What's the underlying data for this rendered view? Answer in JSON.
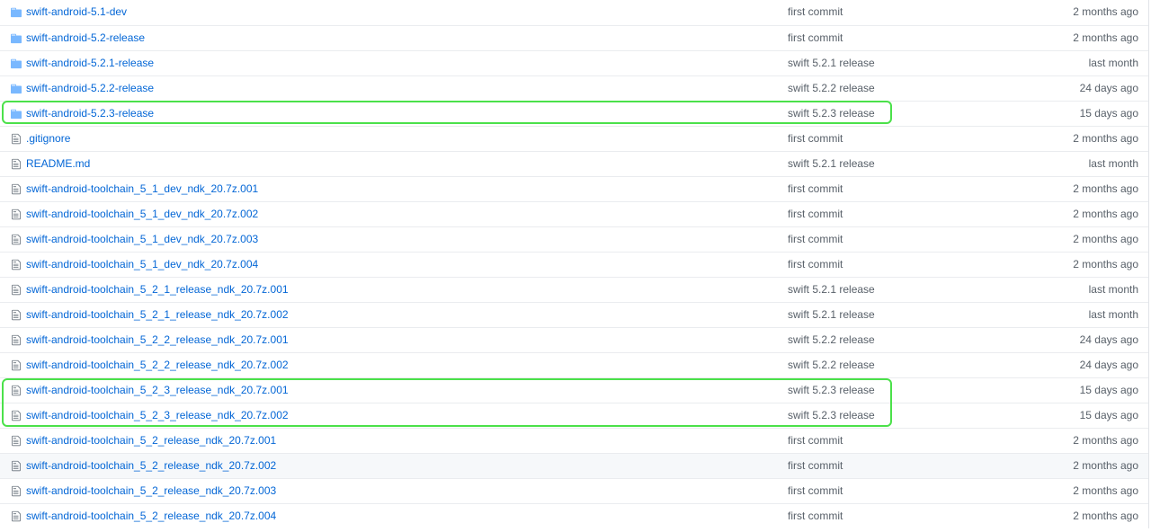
{
  "files": [
    {
      "type": "dir",
      "name": "swift-android-5.1-dev",
      "message": "first commit",
      "age": "2 months ago"
    },
    {
      "type": "dir",
      "name": "swift-android-5.2-release",
      "message": "first commit",
      "age": "2 months ago"
    },
    {
      "type": "dir",
      "name": "swift-android-5.2.1-release",
      "message": "swift 5.2.1 release",
      "age": "last month"
    },
    {
      "type": "dir",
      "name": "swift-android-5.2.2-release",
      "message": "swift 5.2.2 release",
      "age": "24 days ago"
    },
    {
      "type": "dir",
      "name": "swift-android-5.2.3-release",
      "message": "swift 5.2.3 release",
      "age": "15 days ago"
    },
    {
      "type": "file",
      "name": ".gitignore",
      "message": "first commit",
      "age": "2 months ago"
    },
    {
      "type": "file",
      "name": "README.md",
      "message": "swift 5.2.1 release",
      "age": "last month"
    },
    {
      "type": "file",
      "name": "swift-android-toolchain_5_1_dev_ndk_20.7z.001",
      "message": "first commit",
      "age": "2 months ago"
    },
    {
      "type": "file",
      "name": "swift-android-toolchain_5_1_dev_ndk_20.7z.002",
      "message": "first commit",
      "age": "2 months ago"
    },
    {
      "type": "file",
      "name": "swift-android-toolchain_5_1_dev_ndk_20.7z.003",
      "message": "first commit",
      "age": "2 months ago"
    },
    {
      "type": "file",
      "name": "swift-android-toolchain_5_1_dev_ndk_20.7z.004",
      "message": "first commit",
      "age": "2 months ago"
    },
    {
      "type": "file",
      "name": "swift-android-toolchain_5_2_1_release_ndk_20.7z.001",
      "message": "swift 5.2.1 release",
      "age": "last month"
    },
    {
      "type": "file",
      "name": "swift-android-toolchain_5_2_1_release_ndk_20.7z.002",
      "message": "swift 5.2.1 release",
      "age": "last month"
    },
    {
      "type": "file",
      "name": "swift-android-toolchain_5_2_2_release_ndk_20.7z.001",
      "message": "swift 5.2.2 release",
      "age": "24 days ago"
    },
    {
      "type": "file",
      "name": "swift-android-toolchain_5_2_2_release_ndk_20.7z.002",
      "message": "swift 5.2.2 release",
      "age": "24 days ago"
    },
    {
      "type": "file",
      "name": "swift-android-toolchain_5_2_3_release_ndk_20.7z.001",
      "message": "swift 5.2.3 release",
      "age": "15 days ago"
    },
    {
      "type": "file",
      "name": "swift-android-toolchain_5_2_3_release_ndk_20.7z.002",
      "message": "swift 5.2.3 release",
      "age": "15 days ago"
    },
    {
      "type": "file",
      "name": "swift-android-toolchain_5_2_release_ndk_20.7z.001",
      "message": "first commit",
      "age": "2 months ago"
    },
    {
      "type": "file",
      "name": "swift-android-toolchain_5_2_release_ndk_20.7z.002",
      "message": "first commit",
      "age": "2 months ago"
    },
    {
      "type": "file",
      "name": "swift-android-toolchain_5_2_release_ndk_20.7z.003",
      "message": "first commit",
      "age": "2 months ago"
    },
    {
      "type": "file",
      "name": "swift-android-toolchain_5_2_release_ndk_20.7z.004",
      "message": "first commit",
      "age": "2 months ago"
    }
  ],
  "icons": {
    "dir": "folder-icon",
    "file": "file-icon"
  },
  "colors": {
    "link": "#0366d6",
    "muted_text": "#586069",
    "folder_icon": "#79b8ff",
    "file_icon": "#6a737d",
    "highlight_outline": "#4be14a",
    "hover_row": "#f6f8fa"
  },
  "hovered_row": 18,
  "highlighted_groups": [
    [
      4,
      4
    ],
    [
      15,
      16
    ]
  ]
}
